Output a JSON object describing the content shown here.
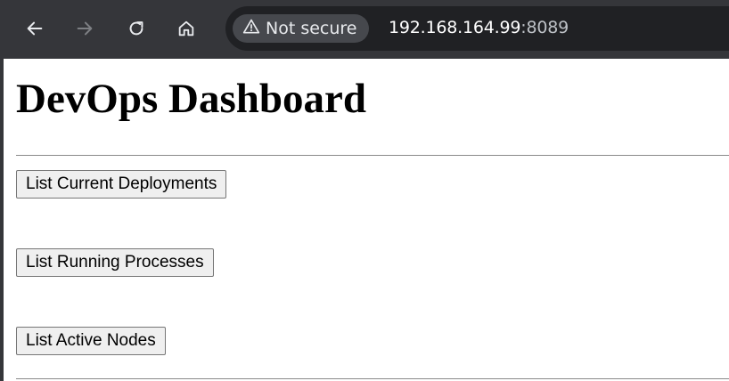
{
  "browser": {
    "back_icon": "arrow-left-icon",
    "forward_icon": "arrow-right-icon",
    "reload_icon": "reload-icon",
    "home_icon": "home-icon",
    "security_icon": "warning-triangle-icon",
    "security_label": "Not secure",
    "url_host": "192.168.164.99",
    "url_port": ":8089",
    "colors": {
      "toolbar": "#35363a",
      "omnibox": "#202124",
      "chip": "#46484d"
    }
  },
  "page": {
    "title": "DevOps Dashboard",
    "buttons": [
      {
        "label": "List Current Deployments"
      },
      {
        "label": "List Running Processes"
      },
      {
        "label": "List Active Nodes"
      }
    ]
  }
}
